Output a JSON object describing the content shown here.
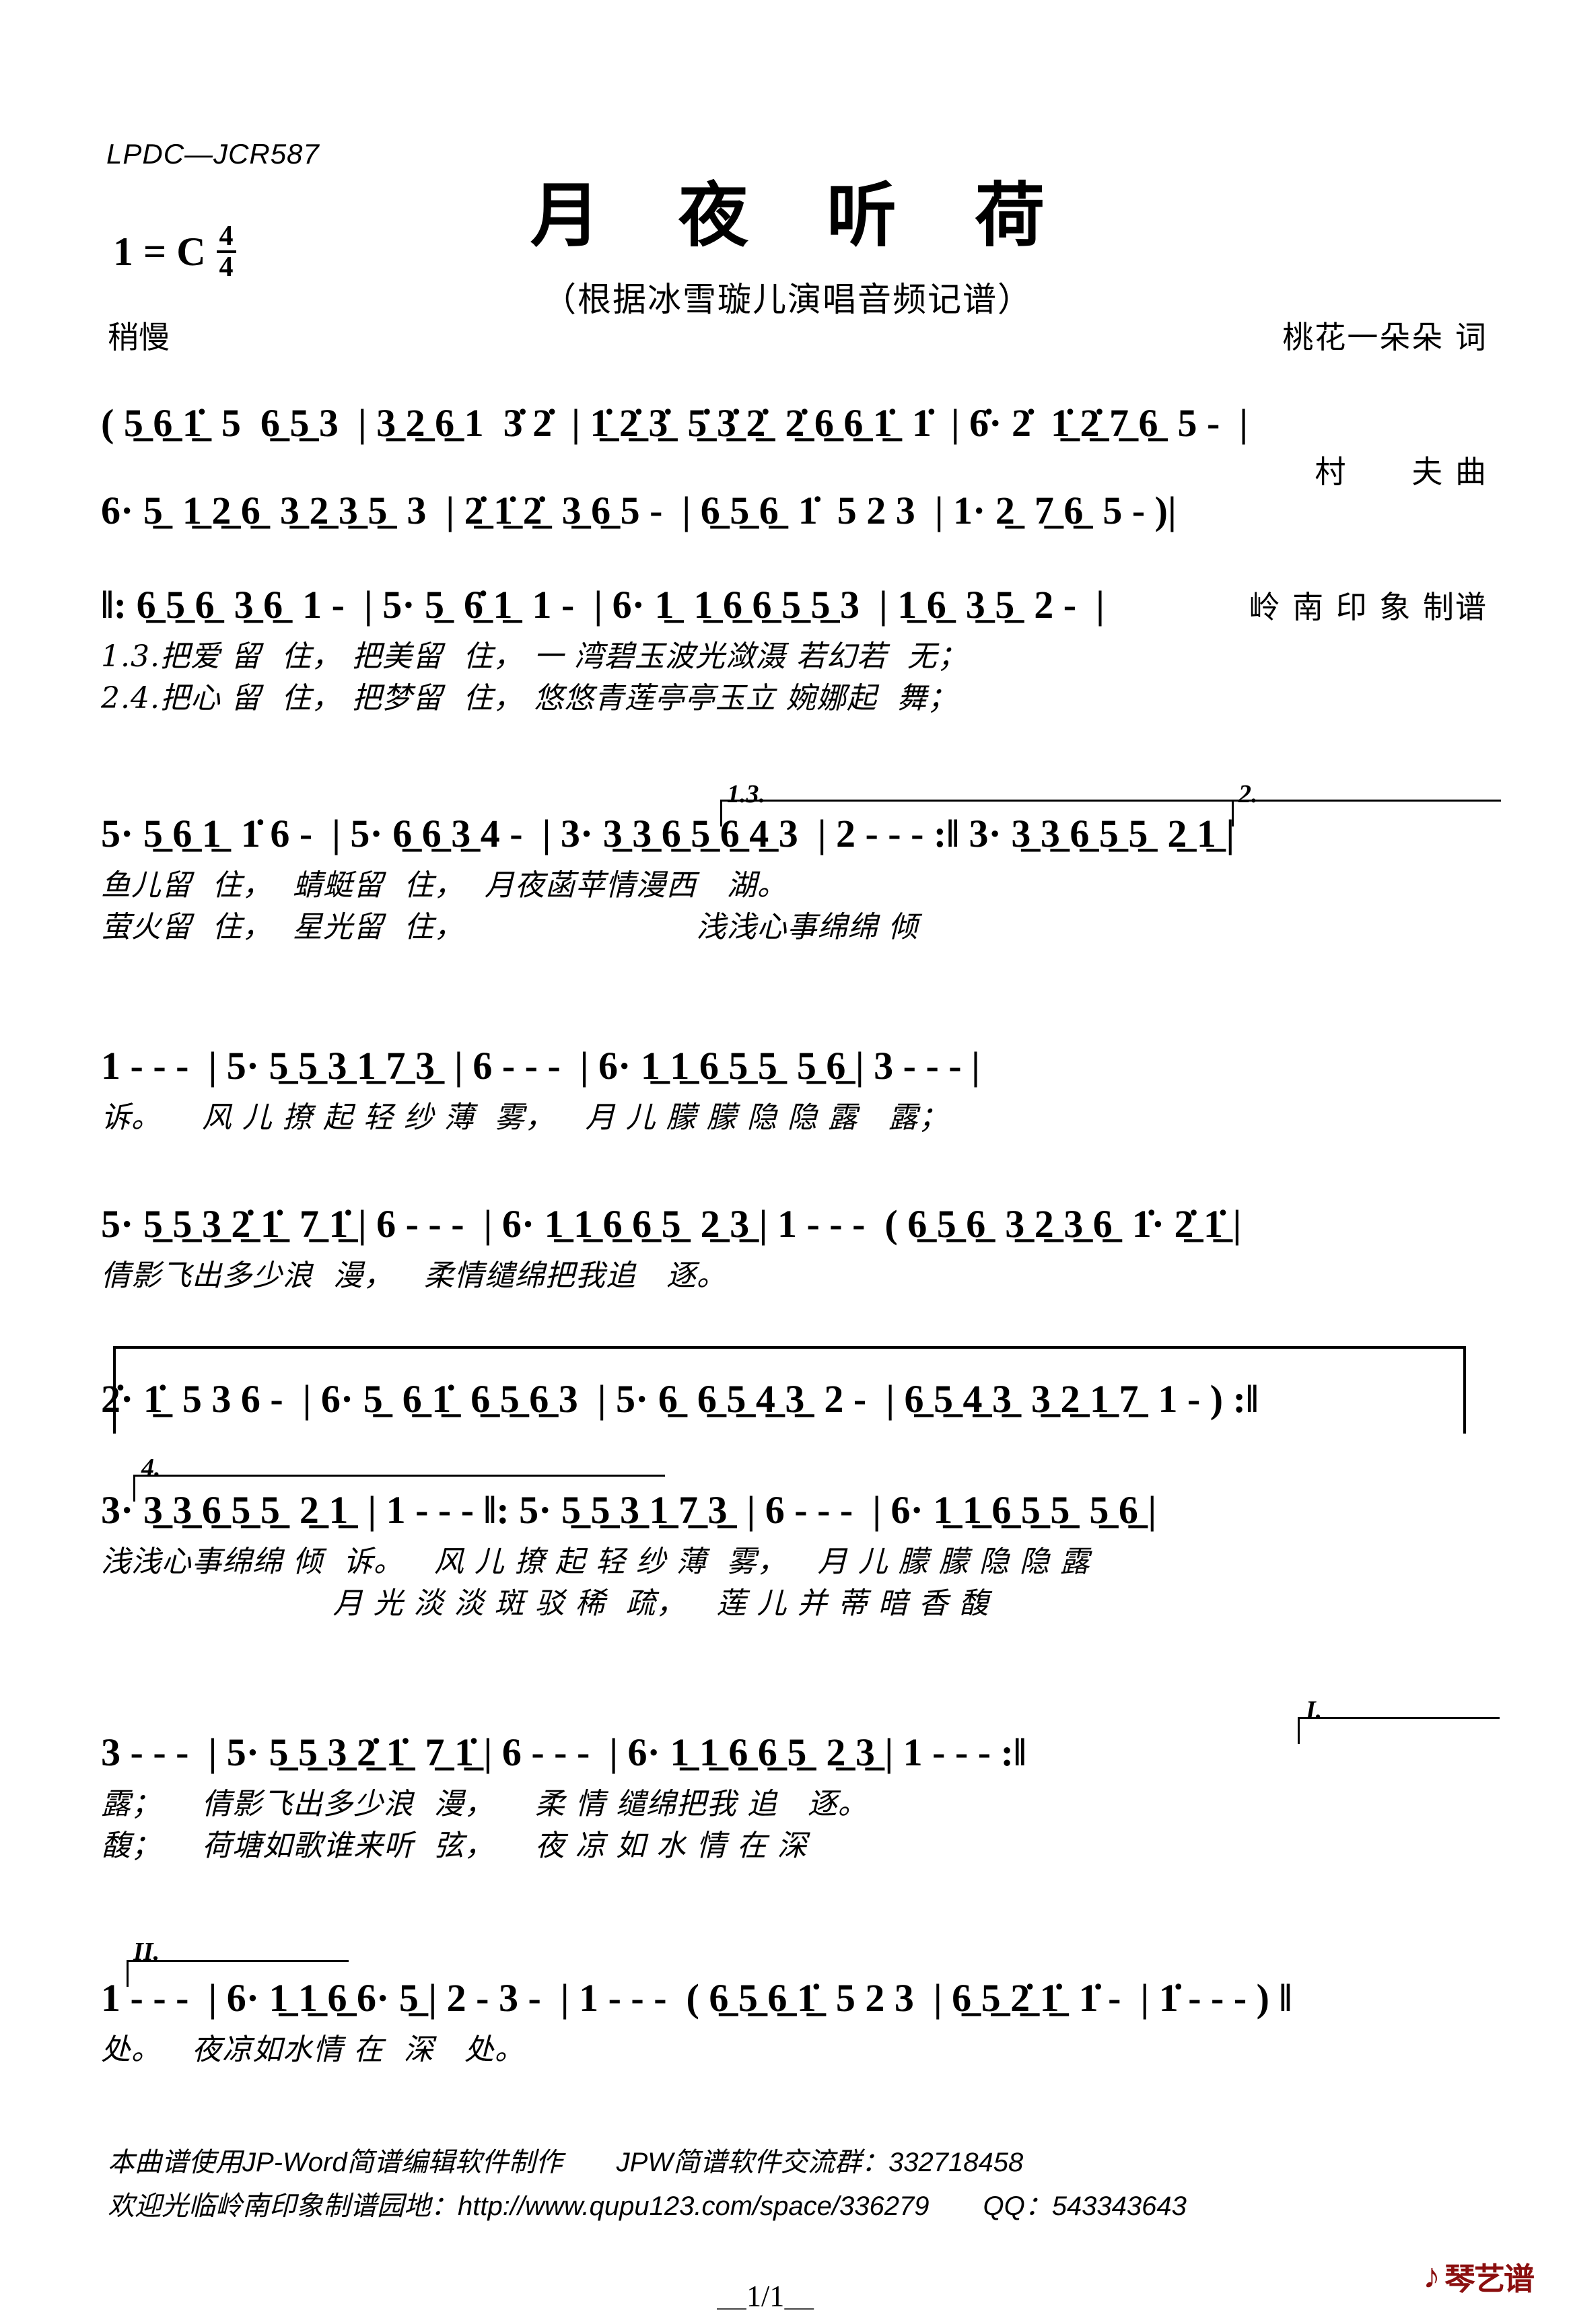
{
  "header": {
    "code": "LPDC—JCR587",
    "title": "月 夜 听 荷",
    "subtitle": "（根据冰雪璇儿演唱音频记谱）",
    "key_label": "1 = C",
    "meter_num": "4",
    "meter_den": "4",
    "tempo": "稍慢",
    "credits": [
      "桃花一朵朵 词",
      "村　　夫 曲",
      "岭 南 印 象 制谱"
    ]
  },
  "score": {
    "type": "jianpu",
    "rows": [
      {
        "id": "row1",
        "notes": "( 5̲ 6̲ 1̲̇  5  6̲ 5̲ 3  | 3̲ 2̲ 6̲ 1  3̇ 2̇  | 1̲̇ 2̲̇ 3̲̇  5̲̇ 3̲̇ 2̲̇  2̲̇ 6̲ 6̲ 1̲̇  1̇  | 6̇· 2̇  1̲̇ 2̲̇ 7̲ 6̲  5 -  |",
        "lyrics": []
      },
      {
        "id": "row2",
        "notes": "6· 5̲  1̲ 2̲ 6̲  3̲ 2̲ 3̲ 5̲  3  | 2̲̇ 1̲̇ 2̲̇  3̲ 6̲ 5 -  | 6̲ 5̲ 6̲  1̇  5 2 3  | 1· 2̲  7̲ 6̲  5 - )|",
        "lyrics": []
      },
      {
        "id": "row3",
        "notes": "‖: 6̲ 5̲ 6̲  3̲ 6̲  1 -  | 5· 5̲  6̲̇ 1̲  1 -  | 6· 1̲  1̲ 6̲ 6̲ 5̲ 5̲ 3  | 1̲ 6̲  3̲ 5̲  2 -  |",
        "lyrics": [
          "1.3.把爱 留  住， 把美留  住， 一 湾碧玉波光潋滠 若幻若  无；",
          "2.4.把心 留  住， 把梦留  住， 悠悠青莲亭亭玉立 婉娜起  舞；"
        ]
      },
      {
        "id": "row4",
        "notes": "5· 5̲ 6̲ 1̲  1̇ 6 -  | 5· 6̲ 6̲ 3̲ 4 -  | 3· 3̲ 3̲ 6̲ 5̲ 6̲ 4̲ 3  | 2 - - - :‖ 3· 3̲ 3̲ 6̲ 5̲ 5̲  2̲ 1̲ |",
        "endings": [
          "1.3.",
          "2."
        ],
        "lyrics": [
          "鱼儿留  住，  蜻蜓留  住，  月夜菡苹情漫西   湖。",
          "萤火留  住，  星光留  住，                       浅浅心事绵绵 倾"
        ]
      },
      {
        "id": "row5",
        "notes": "1 - - -  | 5· 5̲ 5̲ 3̲ 1̲ 7̲ 3̲  | 6 - - -  | 6· 1̲ 1̲ 6̲ 5̲ 5̲  5̲ 6̲ | 3 - - - |",
        "lyrics": [
          "诉。    风 儿 撩 起 轻 纱 薄  雾，   月 儿 朦 朦 隐 隐 露   露；"
        ]
      },
      {
        "id": "row6",
        "notes": "5· 5̲ 5̲ 3̲ 2̲̇ 1̲̇  7̲ 1̲̇ | 6 - - -  | 6· 1̲ 1̲ 6̲ 6̲ 5̲  2̲ 3̲ | 1 - - -  ( 6̲ 5̲ 6̲  3̲ 2̲ 3̲ 6̲  1̇· 2̲̇ 1̲̇ |",
        "lyrics": [
          "倩影飞出多少浪  漫，   柔情缱绵把我追   逐。"
        ]
      },
      {
        "id": "row7",
        "notes": "2̇· 1̲̇  5 3 6 -  | 6· 5̲  6̲ 1̲̇  6̲ 5̲ 6̲ 3  | 5· 6̲  6̲ 5̲ 4̲ 3̲  2 -  | 6̲ 5̲ 4̲ 3̲  3̲ 2̲ 1̲ 7̲  1 - ) :‖",
        "lyrics": []
      },
      {
        "id": "row8",
        "notes": "3· 3̲ 3̲ 6̲ 5̲ 5̲  2̲ 1̲  | 1 - - - ‖: 5· 5̲ 5̲ 3̲ 1̲ 7̲ 3̲  | 6 - - -  | 6· 1̲ 1̲ 6̲ 5̲ 5̲  5̲ 6̲ |",
        "endings": [
          "4."
        ],
        "lyrics": [
          "浅浅心事绵绵 倾  诉。   风 儿 撩 起 轻 纱 薄  雾，   月 儿 朦 朦 隐 隐 露",
          "                       月 光 淡 淡 斑 驳 稀  疏，   莲 儿 并 蒂 暗 香 馥"
        ]
      },
      {
        "id": "row9",
        "notes": "3 - - -  | 5· 5̲ 5̲ 3̲ 2̲̇ 1̲̇  7̲ 1̲̇ | 6 - - -  | 6· 1̲ 1̲ 6̲ 6̲ 5̲  2̲ 3̲ | 1 - - - :‖",
        "endings": [
          "I."
        ],
        "lyrics": [
          "露；    倩影飞出多少浪  漫，    柔 情 缱绵把我 追   逐。",
          "馥；    荷塘如歌谁来听  弦，    夜 凉 如 水 情 在 深"
        ]
      },
      {
        "id": "row10",
        "notes": "1 - - -  | 6· 1̲ 1̲ 6̲ 6· 5̲ | 2 - 3 -  | 1 - - -  ( 6̲ 5̲ 6̲ 1̲̇  5 2 3  | 6̲ 5̲ 2̲̇ 1̲̇  1̇ -  | 1̇ - - - ) ‖",
        "endings": [
          "II."
        ],
        "lyrics": [
          "处。   夜凉如水情 在  深   处。"
        ]
      }
    ]
  },
  "footer": {
    "line1": "本曲谱使用JP-Word简谱编辑软件制作　　JPW简谱软件交流群：332718458",
    "line2": "欢迎光临岭南印象制谱园地：http://www.qupu123.com/space/336279　　QQ：543343643",
    "page_number": "＿1/1＿",
    "logo_text": "琴艺谱",
    "logo_color": "#8B0F0F"
  }
}
